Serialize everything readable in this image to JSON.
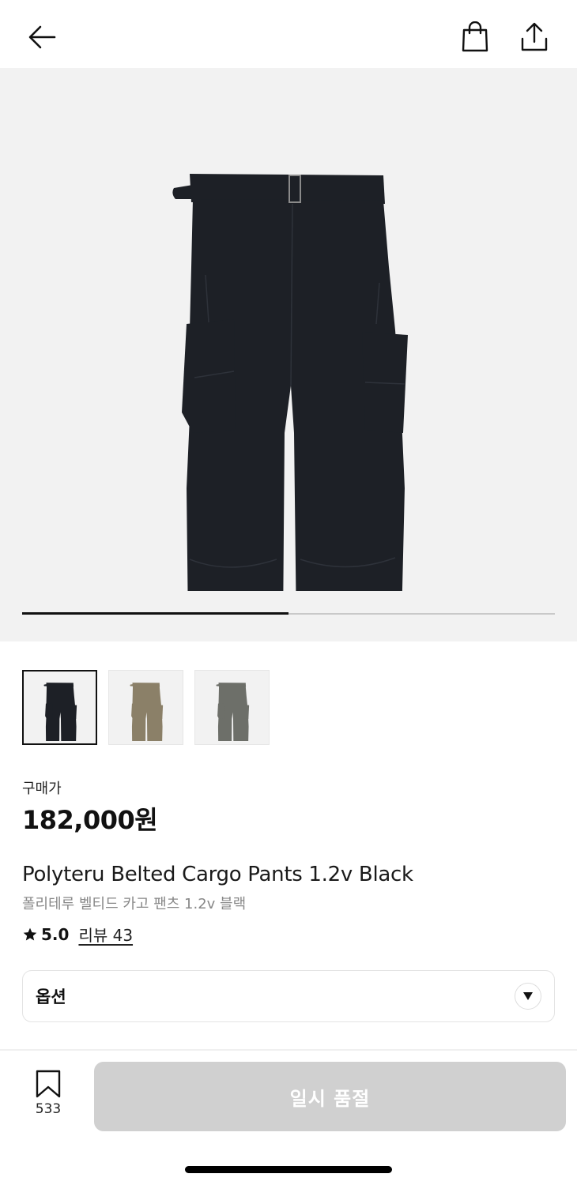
{
  "header": {
    "back_icon": "arrow-left-icon",
    "bag_icon": "shopping-bag-icon",
    "share_icon": "share-icon"
  },
  "gallery": {
    "progress": 0.5,
    "thumbnails": [
      {
        "color_name": "black",
        "color": "#1d2026",
        "selected": true
      },
      {
        "color_name": "khaki",
        "color": "#8b8068",
        "selected": false
      },
      {
        "color_name": "gray",
        "color": "#6d6f69",
        "selected": false
      }
    ]
  },
  "product": {
    "price_label": "구매가",
    "price": "182,000원",
    "title_en": "Polyteru Belted Cargo Pants 1.2v Black",
    "title_ko": "폴리테루 벨티드 카고 팬츠 1.2v 블랙",
    "rating": "5.0",
    "review_text": "리뷰 43"
  },
  "option": {
    "label": "옵션"
  },
  "bottom_bar": {
    "wish_count": "533",
    "soldout_label": "일시 품절"
  },
  "colors": {
    "product_black": "#1d2026",
    "button_disabled": "#d0d0d0",
    "hero_bg": "#f2f2f2"
  }
}
